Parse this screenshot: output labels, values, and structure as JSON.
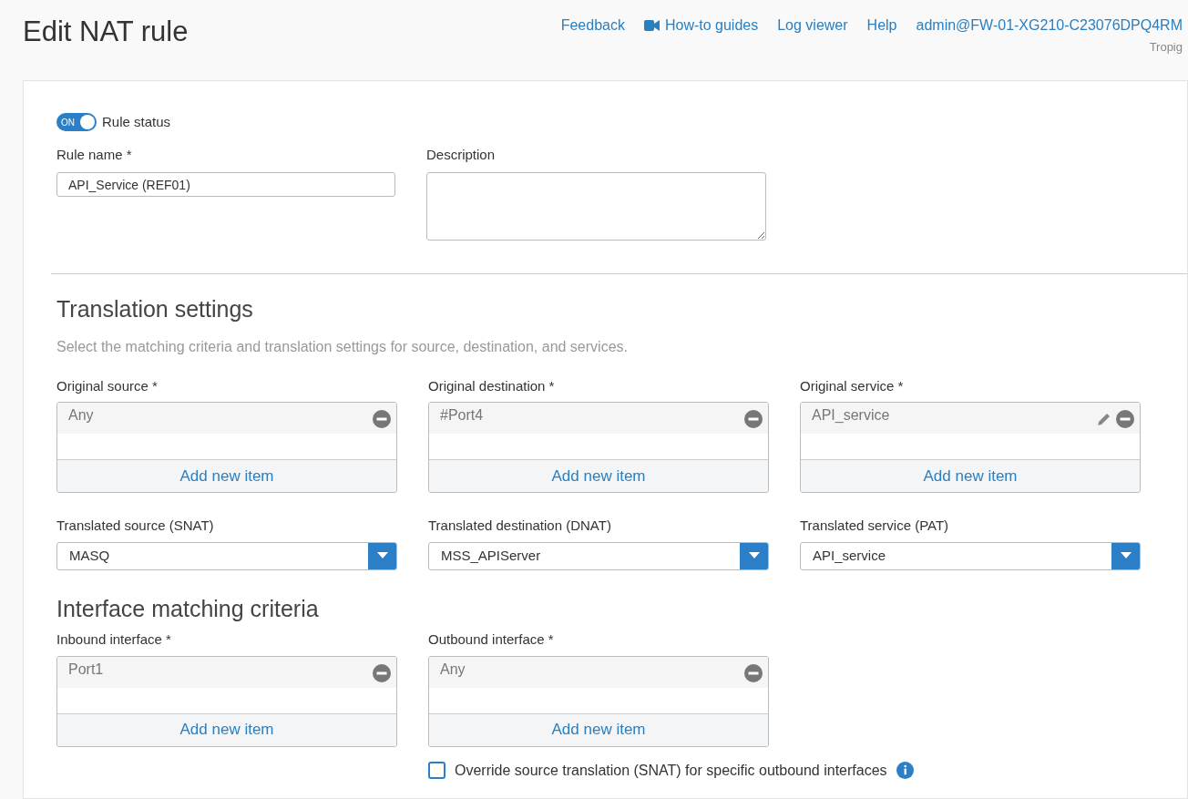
{
  "header": {
    "title": "Edit NAT rule",
    "links": [
      {
        "label": "Feedback",
        "kind": "text"
      },
      {
        "label": "How-to guides",
        "kind": "video"
      },
      {
        "label": "Log viewer",
        "kind": "text"
      },
      {
        "label": "Help",
        "kind": "text"
      }
    ],
    "user": "admin@FW-01-XG210-C23076DPQ4RM",
    "org": "Tropig"
  },
  "rule_status": {
    "label": "Rule status",
    "toggle_text": "ON",
    "on": true
  },
  "rule_name": {
    "label": "Rule name *",
    "value": "API_Service (REF01)"
  },
  "description": {
    "label": "Description"
  },
  "translation": {
    "title": "Translation settings",
    "hint": "Select the matching criteria and translation settings for source, destination, and services.",
    "originals": [
      {
        "label": "Original source *",
        "items": [
          {
            "text": "Any",
            "editable": false
          }
        ],
        "add_label": "Add new item"
      },
      {
        "label": "Original destination *",
        "items": [
          {
            "text": "#Port4",
            "editable": false
          }
        ],
        "add_label": "Add new item"
      },
      {
        "label": "Original service *",
        "items": [
          {
            "text": "API_service",
            "editable": true
          }
        ],
        "add_label": "Add new item"
      }
    ],
    "translated": [
      {
        "label": "Translated source (SNAT)",
        "value": "MASQ"
      },
      {
        "label": "Translated destination (DNAT)",
        "value": "MSS_APIServer"
      },
      {
        "label": "Translated service (PAT)",
        "value": "API_service"
      }
    ]
  },
  "interface": {
    "title": "Interface matching criteria",
    "lists": [
      {
        "label": "Inbound interface *",
        "items": [
          {
            "text": "Port1",
            "editable": false
          }
        ],
        "add_label": "Add new item"
      },
      {
        "label": "Outbound interface *",
        "items": [
          {
            "text": "Any",
            "editable": false
          }
        ],
        "add_label": "Add new item"
      }
    ],
    "override": {
      "label": "Override source translation (SNAT) for specific outbound interfaces",
      "checked": false
    }
  }
}
